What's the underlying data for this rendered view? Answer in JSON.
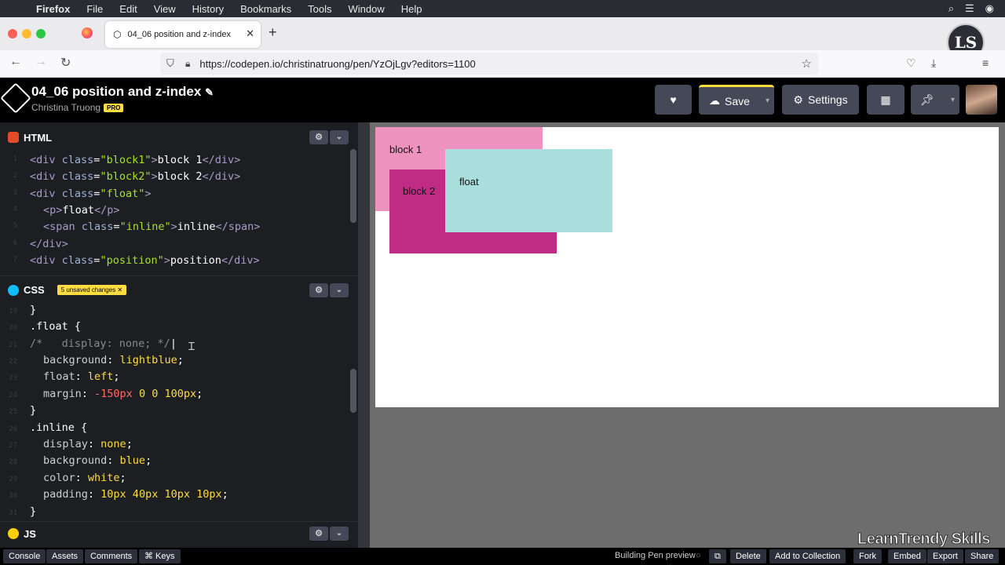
{
  "menubar": {
    "items": [
      "Firefox",
      "File",
      "Edit",
      "View",
      "History",
      "Bookmarks",
      "Tools",
      "Window",
      "Help"
    ]
  },
  "browser": {
    "tab_title": "04_06 position and z-index",
    "url": "https://codepen.io/christinatruong/pen/YzOjLgv?editors=1100",
    "profile_initials": "LS"
  },
  "codepen": {
    "pen_title": "04_06 position and z-index",
    "author": "Christina Truong",
    "pro_badge": "PRO",
    "save_label": "Save",
    "settings_label": "Settings"
  },
  "html_panel": {
    "label": "HTML",
    "lines": [
      {
        "n": "1",
        "code": "<div class=\"block1\">block 1</div>"
      },
      {
        "n": "2",
        "code": "<div class=\"block2\">block 2</div>"
      },
      {
        "n": "3",
        "code": "<div class=\"float\">"
      },
      {
        "n": "4",
        "code": "  <p>float</p>"
      },
      {
        "n": "5",
        "code": "  <span class=\"inline\">inline</span>"
      },
      {
        "n": "6",
        "code": "</div>"
      },
      {
        "n": "7",
        "code": "<div class=\"position\">position</div>"
      }
    ]
  },
  "css_panel": {
    "label": "CSS",
    "unsaved_badge": "5 unsaved changes",
    "lines": [
      {
        "n": "19",
        "code": "}"
      },
      {
        "n": "20",
        "code": ".float {"
      },
      {
        "n": "21",
        "code": "/*   display: none; */"
      },
      {
        "n": "22",
        "code": "  background: lightblue;"
      },
      {
        "n": "23",
        "code": "  float: left;"
      },
      {
        "n": "24",
        "code": "  margin: -150px 0 0 100px;"
      },
      {
        "n": "25",
        "code": "}"
      },
      {
        "n": "26",
        "code": ".inline {"
      },
      {
        "n": "27",
        "code": "  display: none;"
      },
      {
        "n": "28",
        "code": "  background: blue;"
      },
      {
        "n": "29",
        "code": "  color: white;"
      },
      {
        "n": "30",
        "code": "  padding: 10px 40px 10px 10px;"
      },
      {
        "n": "31",
        "code": "}"
      }
    ]
  },
  "js_panel": {
    "label": "JS"
  },
  "preview": {
    "block1": "block 1",
    "block2": "block 2",
    "float": "float",
    "colors": {
      "block1": "#ee93c0",
      "block2": "#c02c84",
      "float": "#a8dedb"
    }
  },
  "footer": {
    "left": [
      "Console",
      "Assets",
      "Comments",
      "⌘ Keys"
    ],
    "status": "Building Pen preview",
    "right": [
      "Delete",
      "Add to Collection",
      "Fork",
      "Embed",
      "Export",
      "Share"
    ]
  },
  "watermark": "LearnTrendy Skills"
}
